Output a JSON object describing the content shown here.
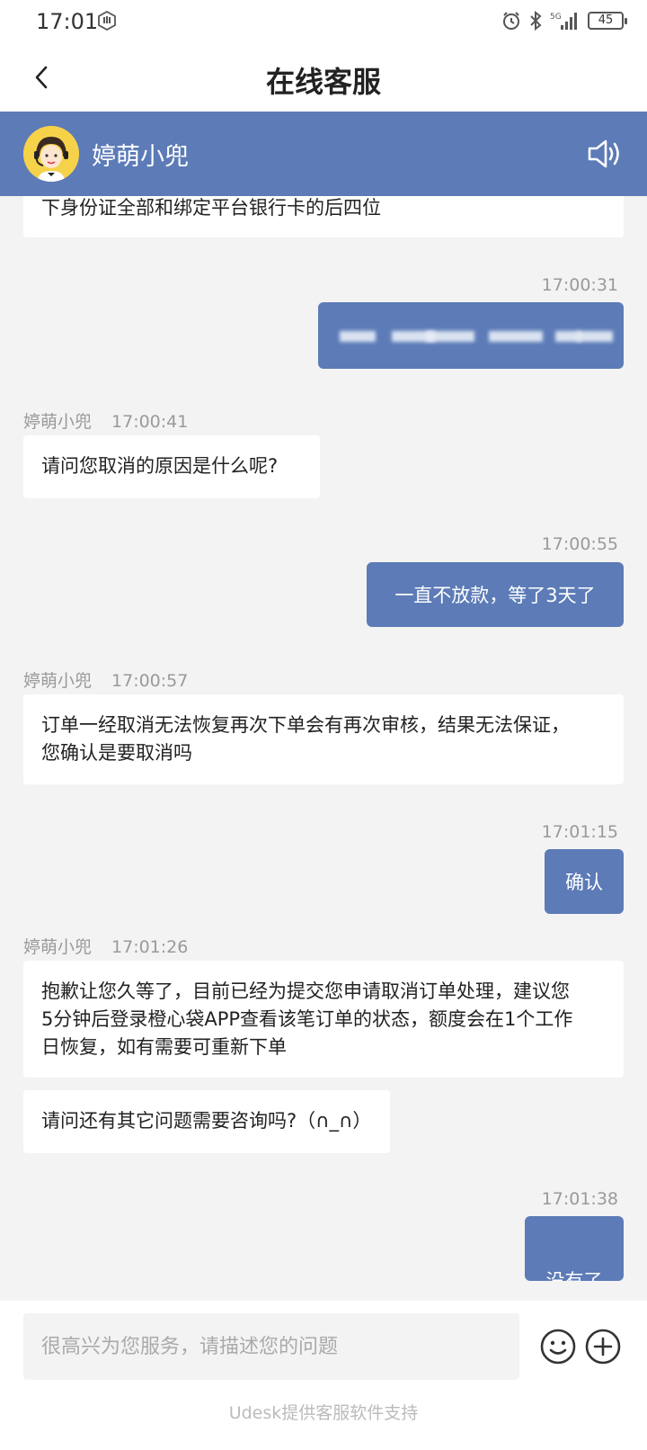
{
  "status_bar": {
    "time": "17:01",
    "network": "5G",
    "battery": "45"
  },
  "nav": {
    "title": "在线客服"
  },
  "agent": {
    "name": "婷萌小兜"
  },
  "messages": [
    {
      "side": "agent",
      "text": "下身份证全部和绑定平台银行卡的后四位"
    },
    {
      "side": "user",
      "time": "17:00:31",
      "text": ""
    },
    {
      "side": "agent",
      "name": "婷萌小兜",
      "time": "17:00:41",
      "text": "请问您取消的原因是什么呢?"
    },
    {
      "side": "user",
      "time": "17:00:55",
      "text": "一直不放款，等了3天了"
    },
    {
      "side": "agent",
      "name": "婷萌小兜",
      "time": "17:00:57",
      "lines": [
        "订单一经取消无法恢复再次下单会有再次审核，结果无法保证，",
        "您确认是要取消吗"
      ]
    },
    {
      "side": "user",
      "time": "17:01:15",
      "text": "确认"
    },
    {
      "side": "agent",
      "name": "婷萌小兜",
      "time": "17:01:26",
      "lines": [
        "抱歉让您久等了，目前已经为提交您申请取消订单处理，建议您",
        "5分钟后登录橙心袋APP查看该笔订单的状态，额度会在1个工作",
        "日恢复，如有需要可重新下单"
      ]
    },
    {
      "side": "agent",
      "text": "请问还有其它问题需要咨询吗?（∩_∩）"
    },
    {
      "side": "user",
      "time": "17:01:38",
      "text": "没有了"
    }
  ],
  "input": {
    "placeholder": "很高兴为您服务，请描述您的问题"
  },
  "footer": {
    "text": "Udesk提供客服软件支持"
  },
  "colors": {
    "accent": "#5c7bb7",
    "background": "#f3f3f3"
  },
  "icons": {
    "back": "chevron-left-icon",
    "speaker": "speaker-icon",
    "emoji": "emoji-icon",
    "plus": "plus-circle-icon"
  }
}
